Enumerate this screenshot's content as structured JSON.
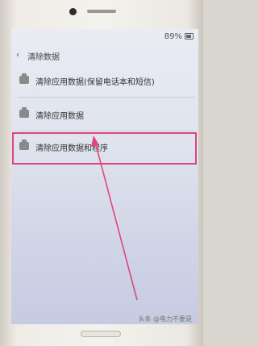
{
  "status_bar": {
    "battery_text": "89%"
  },
  "header": {
    "back_icon": "‹",
    "title": "清除数据"
  },
  "options": [
    {
      "label": "清除应用数据(保留电话本和短信)",
      "icon": "clear-data-icon"
    },
    {
      "label": "清除应用数据",
      "icon": "clear-data-icon"
    },
    {
      "label": "清除应用数据和程序",
      "icon": "clear-data-icon",
      "highlighted": true
    }
  ],
  "annotation": {
    "color": "#e0467a"
  },
  "watermark": "头条 @电力不要是"
}
